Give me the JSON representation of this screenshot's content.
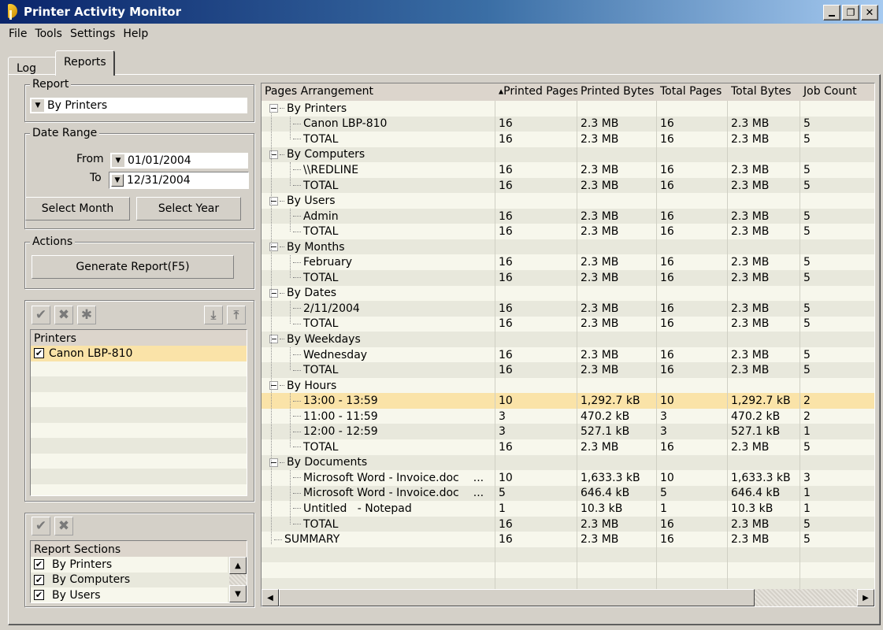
{
  "window": {
    "title": "Printer Activity Monitor",
    "buttons": {
      "minimize": "_",
      "restore": "🗗",
      "close": "✕"
    }
  },
  "menu": [
    "File",
    "Tools",
    "Settings",
    "Help"
  ],
  "tabs": [
    {
      "label": "Log",
      "active": false
    },
    {
      "label": "Reports",
      "active": true
    }
  ],
  "report_group": {
    "label": "Report",
    "selected": "By Printers"
  },
  "date_range": {
    "label": "Date Range",
    "from_label": "From",
    "from_value": "01/01/2004",
    "to_label": "To",
    "to_value": "12/31/2004",
    "select_month": "Select Month",
    "select_year": "Select Year"
  },
  "actions": {
    "label": "Actions",
    "generate": "Generate Report(F5)"
  },
  "printers_panel": {
    "toolbar": [
      "check-all-icon",
      "uncheck-all-icon",
      "invert-icon",
      "import-icon",
      "export-icon"
    ],
    "header": "Printers",
    "items": [
      {
        "label": "Canon LBP-810",
        "checked": true
      }
    ]
  },
  "sections_panel": {
    "toolbar": [
      "check-all-icon",
      "uncheck-all-icon"
    ],
    "header": "Report Sections",
    "items": [
      {
        "label": "By Printers",
        "checked": true
      },
      {
        "label": "By Computers",
        "checked": true
      },
      {
        "label": "By Users",
        "checked": true
      }
    ]
  },
  "grid": {
    "sort_indicator": "▲",
    "columns": [
      "Pages Arrangement",
      "Printed Pages",
      "Printed Bytes",
      "Total Pages",
      "Total Bytes",
      "Job Count"
    ],
    "rows": [
      {
        "level": 0,
        "label": "By Printers",
        "cells": [
          "",
          "",
          "",
          "",
          ""
        ]
      },
      {
        "level": 1,
        "label": "Canon LBP-810",
        "cells": [
          "16",
          "2.3 MB",
          "16",
          "2.3 MB",
          "5"
        ]
      },
      {
        "level": 1,
        "label": "TOTAL",
        "cells": [
          "16",
          "2.3 MB",
          "16",
          "2.3 MB",
          "5"
        ]
      },
      {
        "level": 0,
        "label": "By Computers",
        "cells": [
          "",
          "",
          "",
          "",
          ""
        ]
      },
      {
        "level": 1,
        "label": "\\\\REDLINE",
        "cells": [
          "16",
          "2.3 MB",
          "16",
          "2.3 MB",
          "5"
        ]
      },
      {
        "level": 1,
        "label": "TOTAL",
        "cells": [
          "16",
          "2.3 MB",
          "16",
          "2.3 MB",
          "5"
        ]
      },
      {
        "level": 0,
        "label": "By Users",
        "cells": [
          "",
          "",
          "",
          "",
          ""
        ]
      },
      {
        "level": 1,
        "label": "Admin",
        "cells": [
          "16",
          "2.3 MB",
          "16",
          "2.3 MB",
          "5"
        ]
      },
      {
        "level": 1,
        "label": "TOTAL",
        "cells": [
          "16",
          "2.3 MB",
          "16",
          "2.3 MB",
          "5"
        ]
      },
      {
        "level": 0,
        "label": "By Months",
        "cells": [
          "",
          "",
          "",
          "",
          ""
        ]
      },
      {
        "level": 1,
        "label": "February",
        "cells": [
          "16",
          "2.3 MB",
          "16",
          "2.3 MB",
          "5"
        ]
      },
      {
        "level": 1,
        "label": "TOTAL",
        "cells": [
          "16",
          "2.3 MB",
          "16",
          "2.3 MB",
          "5"
        ]
      },
      {
        "level": 0,
        "label": "By Dates",
        "cells": [
          "",
          "",
          "",
          "",
          ""
        ]
      },
      {
        "level": 1,
        "label": "2/11/2004",
        "cells": [
          "16",
          "2.3 MB",
          "16",
          "2.3 MB",
          "5"
        ]
      },
      {
        "level": 1,
        "label": "TOTAL",
        "cells": [
          "16",
          "2.3 MB",
          "16",
          "2.3 MB",
          "5"
        ]
      },
      {
        "level": 0,
        "label": "By Weekdays",
        "cells": [
          "",
          "",
          "",
          "",
          ""
        ]
      },
      {
        "level": 1,
        "label": "Wednesday",
        "cells": [
          "16",
          "2.3 MB",
          "16",
          "2.3 MB",
          "5"
        ]
      },
      {
        "level": 1,
        "label": "TOTAL",
        "cells": [
          "16",
          "2.3 MB",
          "16",
          "2.3 MB",
          "5"
        ]
      },
      {
        "level": 0,
        "label": "By Hours",
        "cells": [
          "",
          "",
          "",
          "",
          ""
        ]
      },
      {
        "level": 1,
        "label": "13:00 - 13:59",
        "cells": [
          "10",
          "1,292.7 kB",
          "10",
          "1,292.7 kB",
          "2"
        ],
        "selected": true
      },
      {
        "level": 1,
        "label": "11:00 - 11:59",
        "cells": [
          "3",
          "470.2 kB",
          "3",
          "470.2 kB",
          "2"
        ]
      },
      {
        "level": 1,
        "label": "12:00 - 12:59",
        "cells": [
          "3",
          "527.1 kB",
          "3",
          "527.1 kB",
          "1"
        ]
      },
      {
        "level": 1,
        "label": "TOTAL",
        "cells": [
          "16",
          "2.3 MB",
          "16",
          "2.3 MB",
          "5"
        ]
      },
      {
        "level": 0,
        "label": "By Documents",
        "cells": [
          "",
          "",
          "",
          "",
          ""
        ]
      },
      {
        "level": 1,
        "label": "Microsoft Word - Invoice.doc",
        "ellipsis": "...",
        "cells": [
          "10",
          "1,633.3 kB",
          "10",
          "1,633.3 kB",
          "3"
        ]
      },
      {
        "level": 1,
        "label": "Microsoft Word - Invoice.doc",
        "ellipsis": "...",
        "cells": [
          "5",
          "646.4 kB",
          "5",
          "646.4 kB",
          "1"
        ]
      },
      {
        "level": 1,
        "label": "Untitled   - Notepad",
        "cells": [
          "1",
          "10.3 kB",
          "1",
          "10.3 kB",
          "1"
        ]
      },
      {
        "level": 1,
        "label": "TOTAL",
        "cells": [
          "16",
          "2.3 MB",
          "16",
          "2.3 MB",
          "5"
        ]
      },
      {
        "level": 0,
        "label": "SUMMARY",
        "leaf": true,
        "cells": [
          "16",
          "2.3 MB",
          "16",
          "2.3 MB",
          "5"
        ]
      }
    ],
    "empty_rows": 3
  },
  "colors": {
    "selection": "#fae3a8",
    "row_light": "#f7f7ec",
    "row_dark": "#e8e8dc",
    "header": "#dcd5cc",
    "face": "#d4d0c8"
  }
}
